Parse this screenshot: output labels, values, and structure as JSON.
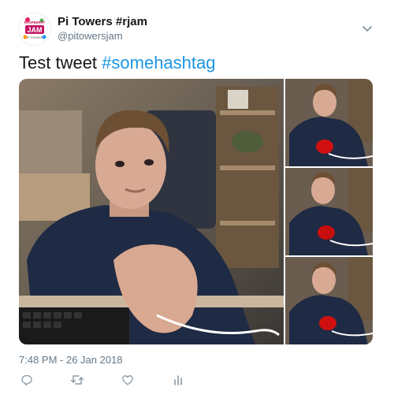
{
  "user": {
    "name": "Pi Towers #rjam",
    "handle": "@pitowersjam"
  },
  "avatar": {
    "text_line1": "RASPBERRY",
    "text_main": "JAM",
    "text_line3": "PI TOWERS"
  },
  "tweet": {
    "text": "Test tweet ",
    "hashtag": "#somehashtag"
  },
  "timestamp": "7:48 PM - 26 Jan 2018",
  "icons": [
    "chevron-down-icon",
    "reply-icon",
    "retweet-icon",
    "like-icon",
    "analytics-icon"
  ],
  "colors": {
    "hashtag": "#1b95e0",
    "secondary": "#657786",
    "icon": "#8899a6"
  }
}
